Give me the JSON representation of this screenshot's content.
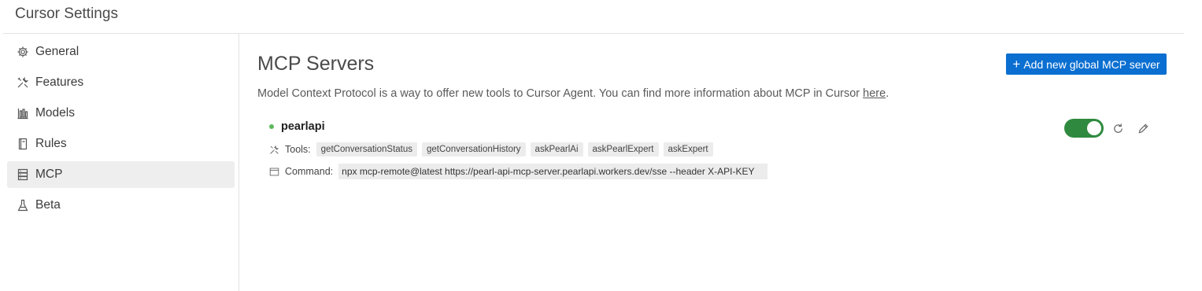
{
  "window": {
    "title": "Cursor Settings"
  },
  "sidebar": {
    "items": [
      {
        "label": "General",
        "icon": "gear-icon",
        "active": false
      },
      {
        "label": "Features",
        "icon": "tools-icon",
        "active": false
      },
      {
        "label": "Models",
        "icon": "bar-chart-icon",
        "active": false
      },
      {
        "label": "Rules",
        "icon": "book-icon",
        "active": false
      },
      {
        "label": "MCP",
        "icon": "server-icon",
        "active": true
      },
      {
        "label": "Beta",
        "icon": "flask-icon",
        "active": false
      }
    ]
  },
  "main": {
    "title": "MCP Servers",
    "add_button_label": "Add new global MCP server",
    "description_text": "Model Context Protocol is a way to offer new tools to Cursor Agent. You can find more information about MCP in Cursor ",
    "description_link": "here",
    "description_end": ".",
    "servers": [
      {
        "name": "pearlapi",
        "status": "connected",
        "status_color": "#5cb85c",
        "enabled": true,
        "tools_label": "Tools:",
        "tools": [
          "getConversationStatus",
          "getConversationHistory",
          "askPearlAi",
          "askPearlExpert",
          "askExpert"
        ],
        "command_label": "Command:",
        "command": "npx mcp-remote@latest https://pearl-api-mcp-server.pearlapi.workers.dev/sse --header X-API-KEY"
      }
    ]
  },
  "colors": {
    "accent": "#0a6fd1",
    "toggle_on": "#2f8a3f",
    "active_nav_bg": "#eeeeee"
  }
}
